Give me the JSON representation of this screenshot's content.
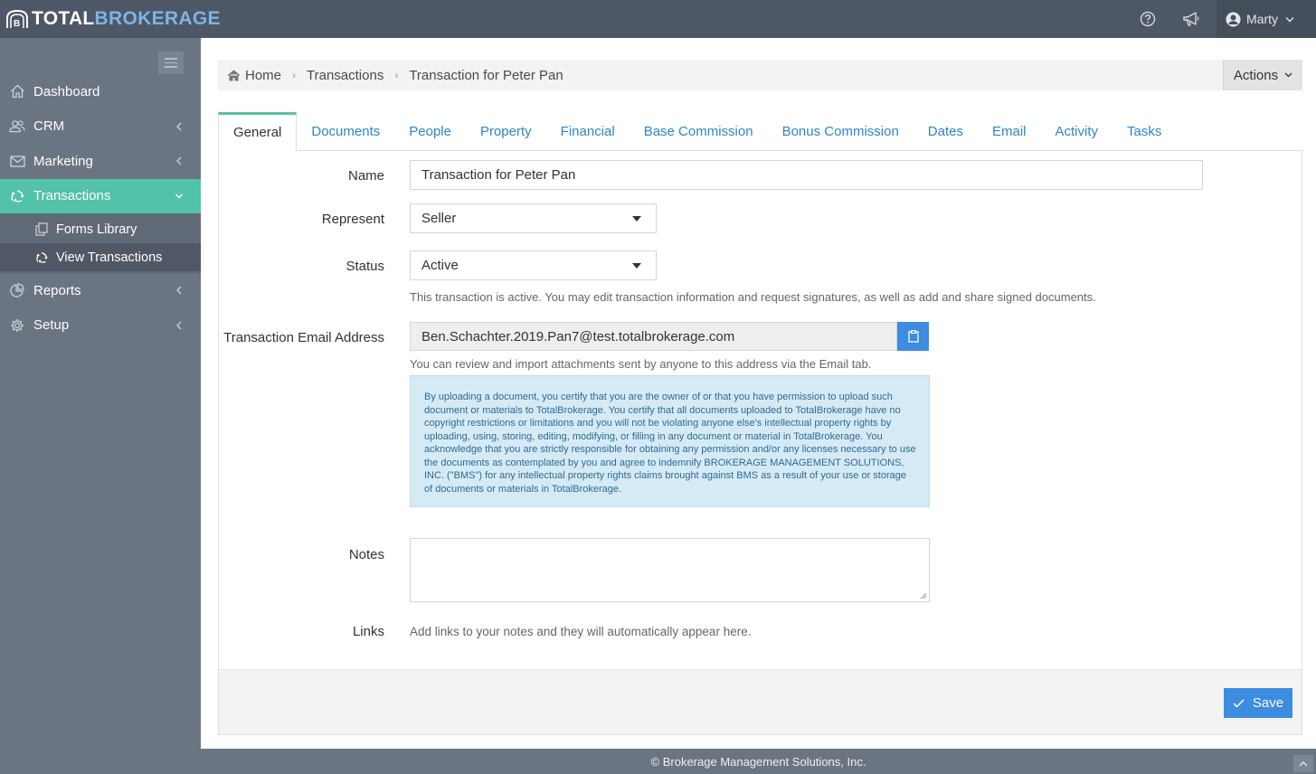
{
  "brand": {
    "total": "TOTAL",
    "brokerage": "BROKERAGE"
  },
  "topbar": {
    "help_icon": "question-circle-icon",
    "announce_icon": "megaphone-icon",
    "user_name": "Marty"
  },
  "sidebar": {
    "items": [
      {
        "label": "Dashboard",
        "icon": "home-icon"
      },
      {
        "label": "CRM",
        "icon": "users-icon"
      },
      {
        "label": "Marketing",
        "icon": "envelope-icon"
      },
      {
        "label": "Transactions",
        "icon": "transactions-icon"
      },
      {
        "label": "Reports",
        "icon": "chart-icon"
      },
      {
        "label": "Setup",
        "icon": "gear-icon"
      }
    ],
    "subitems": [
      {
        "label": "Forms Library",
        "icon": "copy-icon"
      },
      {
        "label": "View Transactions",
        "icon": "transactions-icon"
      }
    ]
  },
  "breadcrumb": {
    "home": "Home",
    "transactions": "Transactions",
    "current": "Transaction for Peter Pan"
  },
  "actions_label": "Actions",
  "tabs": [
    "General",
    "Documents",
    "People",
    "Property",
    "Financial",
    "Base Commission",
    "Bonus Commission",
    "Dates",
    "Email",
    "Activity",
    "Tasks"
  ],
  "form": {
    "name_label": "Name",
    "name_value": "Transaction for Peter Pan",
    "represent_label": "Represent",
    "represent_value": "Seller",
    "status_label": "Status",
    "status_value": "Active",
    "status_help": "This transaction is active. You may edit transaction information and request signatures, as well as add and share signed documents.",
    "email_label": "Transaction Email Address",
    "email_value": "Ben.Schachter.2019.Pan7@test.totalbrokerage.com",
    "email_help": "You can review and import attachments sent by anyone to this address via the Email tab.",
    "notice": "By uploading a document, you certify that you are the owner of or that you have permission to upload such document or materials to TotalBrokerage. You certify that all documents uploaded to TotalBrokerage have no copyright restrictions or limitations and you will not be violating anyone else's intellectual property rights by uploading, using, storing, editing, modifying, or filling in any document or material in TotalBrokerage. You acknowledge that you are strictly responsible for obtaining any permission and/or any licenses necessary to use the documents as contemplated by you and agree to indemnify BROKERAGE MANAGEMENT SOLUTIONS, INC. (\"BMS\") for any intellectual property rights claims brought against BMS as a result of your use or storage of documents or materials in TotalBrokerage.",
    "notes_label": "Notes",
    "links_label": "Links",
    "links_help": "Add links to your notes and they will automatically appear here."
  },
  "save_label": "Save",
  "footer": "© Brokerage Management Solutions, Inc.",
  "colors": {
    "topbar": "#4d5765",
    "sidebar": "#6b7582",
    "accent": "#52c2a8",
    "primary": "#3c8ce0"
  }
}
